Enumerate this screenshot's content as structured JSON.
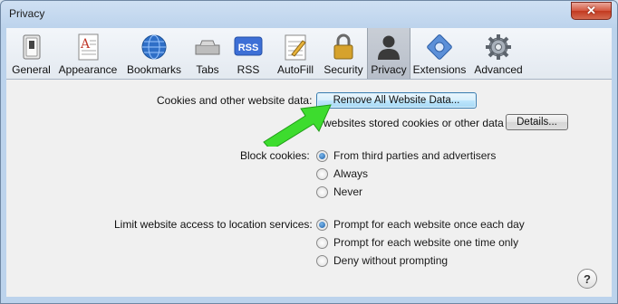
{
  "window": {
    "title": "Privacy",
    "close_glyph": "✕"
  },
  "toolbar": {
    "items": [
      {
        "label": "General",
        "icon": "switch-icon"
      },
      {
        "label": "Appearance",
        "icon": "font-page-icon"
      },
      {
        "label": "Bookmarks",
        "icon": "globe-icon"
      },
      {
        "label": "Tabs",
        "icon": "tabs-icon"
      },
      {
        "label": "RSS",
        "icon": "rss-icon",
        "badge_text": "RSS"
      },
      {
        "label": "AutoFill",
        "icon": "pencil-form-icon"
      },
      {
        "label": "Security",
        "icon": "padlock-icon"
      },
      {
        "label": "Privacy",
        "icon": "person-silhouette-icon",
        "selected": true
      },
      {
        "label": "Extensions",
        "icon": "puzzle-gear-icon"
      },
      {
        "label": "Advanced",
        "icon": "gear-icon"
      }
    ]
  },
  "cookies": {
    "label": "Cookies and other website data:",
    "remove_button": "Remove All Website Data...",
    "stored_text": "websites stored cookies or other data",
    "details_button": "Details..."
  },
  "block_cookies": {
    "label": "Block cookies:",
    "options": [
      "From third parties and advertisers",
      "Always",
      "Never"
    ],
    "selected_index": 0
  },
  "location": {
    "label": "Limit website access to location services:",
    "options": [
      "Prompt for each website once each day",
      "Prompt for each website one time only",
      "Deny without prompting"
    ],
    "selected_index": 0
  },
  "help": {
    "glyph": "?"
  },
  "colors": {
    "annotation_arrow": "#3ddc2e",
    "accent": "#1c5fa8"
  }
}
